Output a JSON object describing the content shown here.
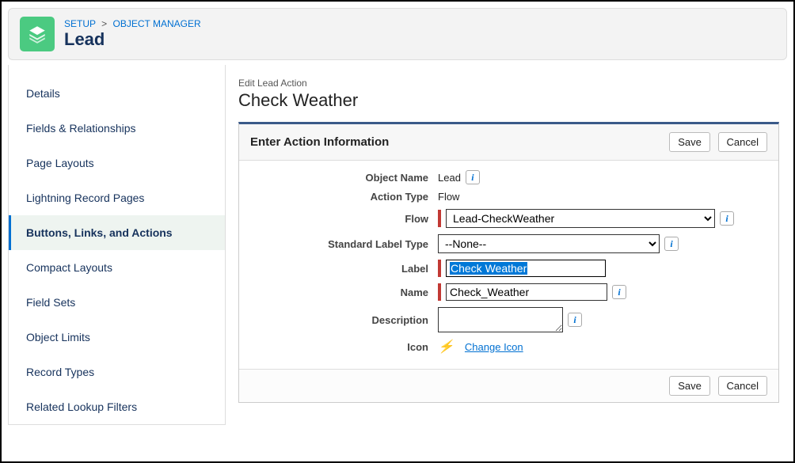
{
  "header": {
    "breadcrumb": {
      "setup": "SETUP",
      "objmgr": "OBJECT MANAGER"
    },
    "title": "Lead",
    "icon": "stack-icon"
  },
  "sidebar": {
    "items": [
      {
        "label": "Details"
      },
      {
        "label": "Fields & Relationships"
      },
      {
        "label": "Page Layouts"
      },
      {
        "label": "Lightning Record Pages"
      },
      {
        "label": "Buttons, Links, and Actions",
        "active": true
      },
      {
        "label": "Compact Layouts"
      },
      {
        "label": "Field Sets"
      },
      {
        "label": "Object Limits"
      },
      {
        "label": "Record Types"
      },
      {
        "label": "Related Lookup Filters"
      }
    ]
  },
  "main": {
    "subtitle": "Edit Lead Action",
    "title": "Check Weather",
    "panel_title": "Enter Action Information",
    "save_label": "Save",
    "cancel_label": "Cancel",
    "fields": {
      "object_name": {
        "label": "Object Name",
        "value": "Lead"
      },
      "action_type": {
        "label": "Action Type",
        "value": "Flow"
      },
      "flow": {
        "label": "Flow",
        "selected": "Lead-CheckWeather"
      },
      "std_label_type": {
        "label": "Standard Label Type",
        "selected": "--None--"
      },
      "label_field": {
        "label": "Label",
        "value": "Check Weather"
      },
      "name_field": {
        "label": "Name",
        "value": "Check_Weather"
      },
      "description": {
        "label": "Description",
        "value": ""
      },
      "icon": {
        "label": "Icon",
        "link": "Change Icon"
      }
    }
  }
}
